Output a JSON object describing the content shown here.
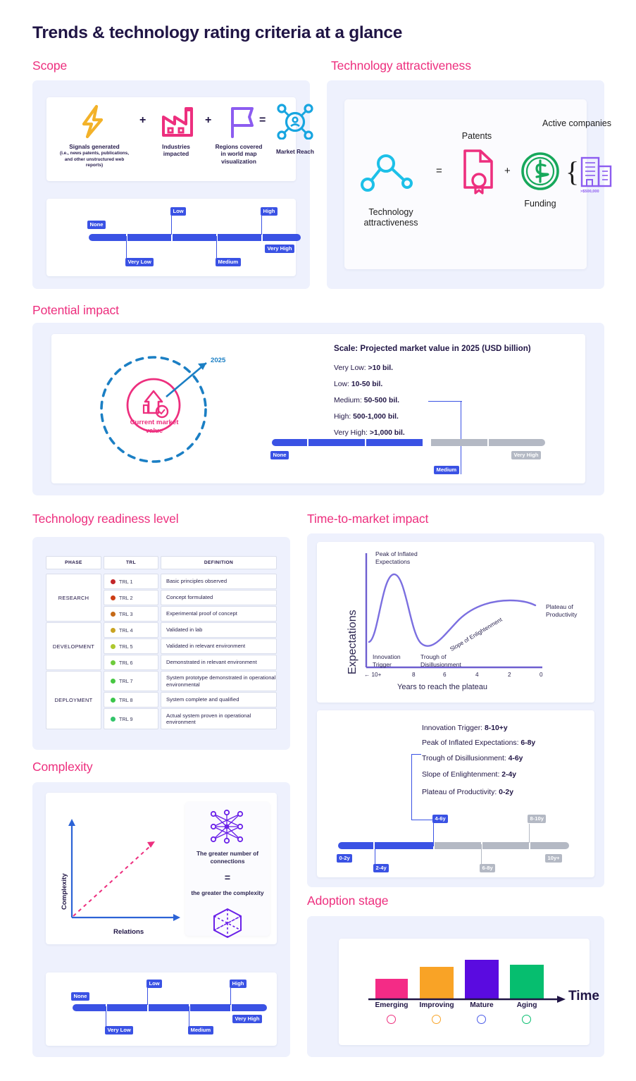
{
  "title": "Trends & technology rating criteria at a glance",
  "accent": "#ED2F7E",
  "sections": {
    "scope": "Scope",
    "tech_attractiveness": "Technology attractiveness",
    "potential_impact": "Potential impact",
    "trl": "Technology readiness level",
    "time_to_market": "Time-to-market impact",
    "complexity": "Complexity",
    "adoption_stage": "Adoption stage"
  },
  "scope": {
    "items": [
      {
        "icon": "lightning-bolt-icon",
        "caption": "Signals generated",
        "sub": "(i.e., news patents, publications, and other unstructured web reports)"
      },
      {
        "icon": "factory-icon",
        "caption": "Industries impacted",
        "sub": ""
      },
      {
        "icon": "flag-icon",
        "caption": "Regions covered in world map visualization",
        "sub": ""
      },
      {
        "icon": "network-reach-icon",
        "caption": "Market Reach",
        "sub": ""
      }
    ],
    "operators": [
      "+",
      "+",
      "="
    ],
    "scale": {
      "labels": [
        "None",
        "Very Low",
        "Low",
        "Medium",
        "High",
        "Very High"
      ],
      "segments": 5
    }
  },
  "tech_attractiveness": {
    "left_label": "Technology attractiveness",
    "equals": "=",
    "plus": "+",
    "patents_label": "Patents",
    "funding_label": "Funding",
    "active_companies_label": "Active companies",
    "company_threshold": ">$500,000",
    "brace": "{"
  },
  "potential_impact": {
    "circle_label": "Current market value",
    "year": "2025",
    "scale_title": "Scale: Projected market value in 2025 (USD billion)",
    "rows": [
      {
        "name": "Very Low:",
        "value": ">10 bil."
      },
      {
        "name": "Low:",
        "value": "10-50 bil."
      },
      {
        "name": "Medium:",
        "value": "50-500 bil."
      },
      {
        "name": "High:",
        "value": "500-1,000 bil."
      },
      {
        "name": "Very High:",
        "value": ">1,000 bil."
      }
    ],
    "scale": {
      "labels": [
        "None",
        "Medium",
        "Very High"
      ],
      "active_segments": 3,
      "total_segments": 5,
      "selected": "Medium"
    }
  },
  "trl": {
    "headers": [
      "PHASE",
      "TRL",
      "DEFINITION"
    ],
    "phases": [
      {
        "name": "RESEARCH",
        "rows": 3
      },
      {
        "name": "DEVELOPMENT",
        "rows": 3
      },
      {
        "name": "DEPLOYMENT",
        "rows": 3
      }
    ],
    "rows": [
      {
        "trl": "TRL 1",
        "color": "#C2262A",
        "definition": "Basic principles observed"
      },
      {
        "trl": "TRL 2",
        "color": "#CC3D14",
        "definition": "Concept formulated"
      },
      {
        "trl": "TRL 3",
        "color": "#C56A17",
        "definition": "Experimental proof of concept"
      },
      {
        "trl": "TRL 4",
        "color": "#C9A321",
        "definition": "Validated in lab"
      },
      {
        "trl": "TRL 5",
        "color": "#AEC82E",
        "definition": "Validated in relevant environment"
      },
      {
        "trl": "TRL 6",
        "color": "#6ECB3C",
        "definition": "Demonstrated in relevant environment"
      },
      {
        "trl": "TRL 7",
        "color": "#47C742",
        "definition": "System prototype demonstrated in operational environmental"
      },
      {
        "trl": "TRL 8",
        "color": "#3BC54A",
        "definition": "System complete and qualified"
      },
      {
        "trl": "TRL 9",
        "color": "#33C46A",
        "definition": "Actual system proven in operational environment"
      }
    ]
  },
  "time_to_market": {
    "chart": {
      "ylabel": "Expectations",
      "xlabel": "Years to reach the plateau",
      "xticks": [
        "← 10+",
        "8",
        "6",
        "4",
        "2",
        "0"
      ],
      "annotations": [
        "Peak of Inflated Expectations",
        "Innovation Trigger",
        "Trough of Disillusionment",
        "Slope of Enlightenment",
        "Plateau of Productivity"
      ],
      "curve_color": "#7B6FE0"
    },
    "rows": [
      {
        "name": "Innovation Trigger:",
        "value": "8-10+y"
      },
      {
        "name": "Peak of Inflated Expectations:",
        "value": "6-8y"
      },
      {
        "name": "Trough of Disillusionment:",
        "value": "4-6y"
      },
      {
        "name": "Slope of Enlightenment:",
        "value": "2-4y"
      },
      {
        "name": "Plateau of Productivity:",
        "value": "0-2y"
      }
    ],
    "scale": {
      "labels": [
        "0-2y",
        "2-4y",
        "4-6y",
        "6-8y",
        "8-10y",
        "10y+"
      ],
      "active_segments": 2,
      "total_segments": 5,
      "selected": "4-6y"
    }
  },
  "complexity": {
    "y_axis": "Complexity",
    "x_axis": "Relations",
    "note_top": "The greater number of connections",
    "note_equals": "=",
    "note_bottom": "the greater the complexity",
    "scale": {
      "labels": [
        "None",
        "Very Low",
        "Low",
        "Medium",
        "High",
        "Very High"
      ],
      "segments": 5
    }
  },
  "chart_data": {
    "type": "bar",
    "title": "Adoption stage",
    "categories": [
      "Emerging",
      "Improving",
      "Mature",
      "Aging"
    ],
    "values": [
      36,
      58,
      72,
      64
    ],
    "colors": [
      "#F42B86",
      "#F9A326",
      "#5A0BE0",
      "#06BE6F"
    ],
    "ring_colors": [
      "#ED2F7E",
      "#F9A326",
      "#4A5BE8",
      "#06BE6F"
    ],
    "xlabel": "Time",
    "ylabel": "",
    "ylim": [
      0,
      80
    ],
    "grid": false,
    "legend": "none"
  }
}
